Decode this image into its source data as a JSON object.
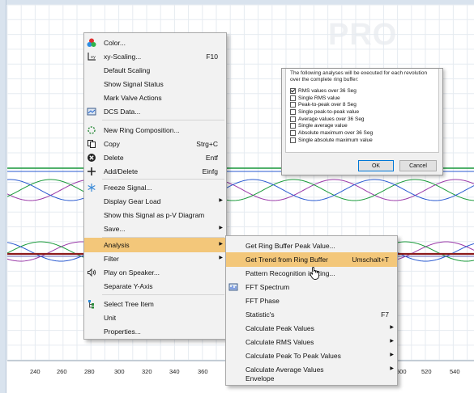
{
  "plot": {
    "x_ticks": [
      "240",
      "260",
      "280",
      "300",
      "320",
      "340",
      "360",
      "500",
      "520",
      "540"
    ],
    "watermark": "PRO"
  },
  "dialog": {
    "description": "The following analyses will be executed for each revolution over the complete ring buffer:",
    "options": [
      {
        "label": "RMS values over 36 Seg",
        "checked": true
      },
      {
        "label": "Single RMS value",
        "checked": false
      },
      {
        "label": "Peak-to-peak over 8 Seg",
        "checked": false
      },
      {
        "label": "Single peak-to-peak value",
        "checked": false
      },
      {
        "label": "Average values over 36 Seg",
        "checked": false
      },
      {
        "label": "Single average value",
        "checked": false
      },
      {
        "label": "Absolute maximum over 36 Seg",
        "checked": false
      },
      {
        "label": "Single absolute maximum value",
        "checked": false
      }
    ],
    "ok_label": "OK",
    "cancel_label": "Cancel"
  },
  "context_menu": {
    "items": [
      {
        "label": "Color...",
        "shortcut": "",
        "icon": "color-palette-icon"
      },
      {
        "label": "xy-Scaling...",
        "shortcut": "F10",
        "icon": "xy-scaling-icon"
      },
      {
        "label": "Default Scaling",
        "shortcut": "",
        "icon": ""
      },
      {
        "label": "Show Signal Status",
        "shortcut": "",
        "icon": ""
      },
      {
        "label": "Mark Valve Actions",
        "shortcut": "",
        "icon": ""
      },
      {
        "label": "DCS Data...",
        "shortcut": "",
        "icon": "dcs-data-icon"
      },
      {
        "label": "New Ring Composition...",
        "shortcut": "",
        "icon": "ring-composition-icon"
      },
      {
        "label": "Copy",
        "shortcut": "Strg+C",
        "icon": "copy-icon"
      },
      {
        "label": "Delete",
        "shortcut": "Entf",
        "icon": "delete-icon"
      },
      {
        "label": "Add/Delete",
        "shortcut": "Einfg",
        "icon": "add-icon"
      },
      {
        "label": "Freeze Signal...",
        "shortcut": "",
        "icon": "freeze-icon"
      },
      {
        "label": "Display Gear Load",
        "shortcut": "",
        "icon": ""
      },
      {
        "label": "Show this Signal as p-V Diagram",
        "shortcut": "",
        "icon": ""
      },
      {
        "label": "Save...",
        "shortcut": "",
        "icon": ""
      },
      {
        "label": "Analysis",
        "shortcut": "",
        "icon": ""
      },
      {
        "label": "Filter",
        "shortcut": "",
        "icon": ""
      },
      {
        "label": "Play on Speaker...",
        "shortcut": "",
        "icon": "speaker-icon"
      },
      {
        "label": "Separate Y-Axis",
        "shortcut": "",
        "icon": ""
      },
      {
        "label": "Select Tree Item",
        "shortcut": "",
        "icon": "tree-item-icon"
      },
      {
        "label": "Unit",
        "shortcut": "",
        "icon": ""
      },
      {
        "label": "Properties...",
        "shortcut": "",
        "icon": ""
      }
    ]
  },
  "analysis_submenu": {
    "items": [
      {
        "label": "Get Ring Buffer Peak Value...",
        "shortcut": ""
      },
      {
        "label": "Get Trend from Ring Buffer",
        "shortcut": "Umschalt+T"
      },
      {
        "label": "Pattern Recognition in Ring...",
        "shortcut": ""
      },
      {
        "label": "FFT Spectrum",
        "shortcut": ""
      },
      {
        "label": "FFT Phase",
        "shortcut": ""
      },
      {
        "label": "Statistic's",
        "shortcut": "F7"
      },
      {
        "label": "Calculate Peak Values",
        "shortcut": ""
      },
      {
        "label": "Calculate RMS Values",
        "shortcut": ""
      },
      {
        "label": "Calculate Peak To Peak Values",
        "shortcut": ""
      },
      {
        "label": "Calculate Average Values",
        "shortcut": ""
      },
      {
        "label": "Envelope",
        "shortcut": ""
      }
    ]
  },
  "colors": {
    "highlight": "#f3c77a",
    "signal_green": "#1a9a3a",
    "signal_purple": "#9a3aa8",
    "signal_blue": "#2a5ad0",
    "signal_darkred": "#8b1a1a"
  }
}
